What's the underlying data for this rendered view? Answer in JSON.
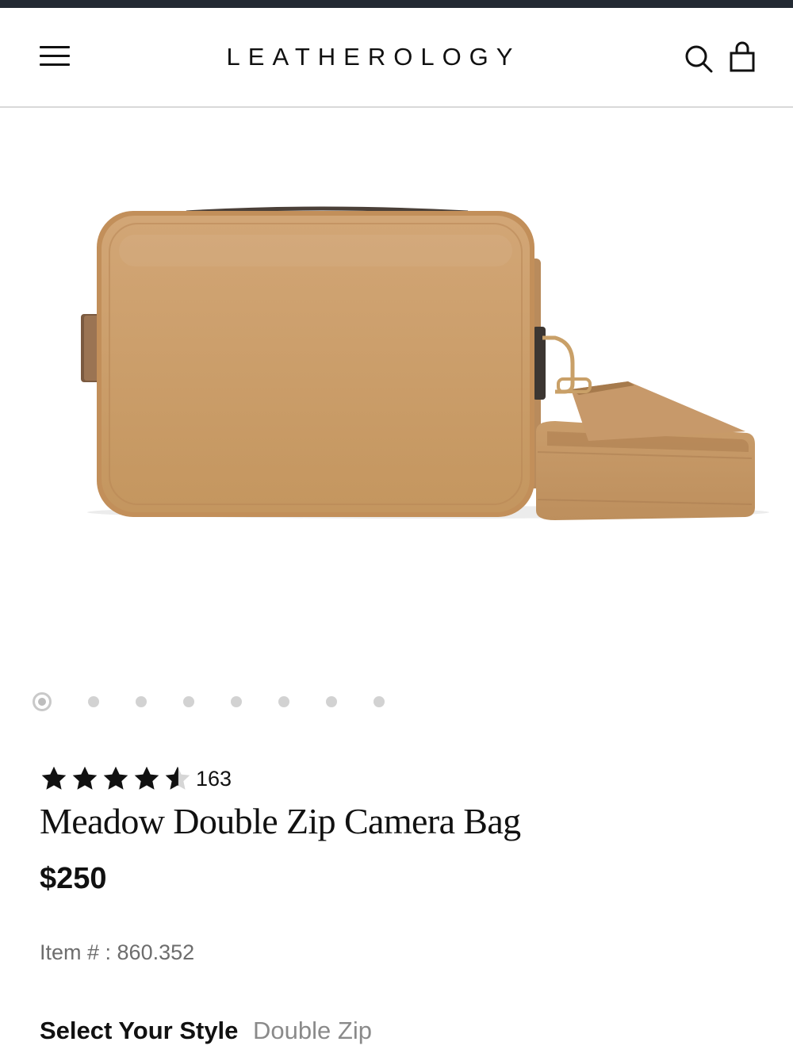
{
  "header": {
    "logo": "LEATHEROLOGY",
    "menu_icon": "hamburger-menu-icon",
    "search_icon": "search-icon",
    "cart_icon": "shopping-bag-icon"
  },
  "gallery": {
    "image_alt": "Meadow Double Zip Camera Bag",
    "slide_count": 8,
    "active_slide": 1,
    "bag_color": "#c99c6c"
  },
  "product": {
    "rating": 4.5,
    "review_count": "163",
    "title": "Meadow Double Zip Camera Bag",
    "price": "$250",
    "item_number": "Item # : 860.352"
  },
  "style_selector": {
    "label": "Select Your Style",
    "value": "Double Zip"
  }
}
